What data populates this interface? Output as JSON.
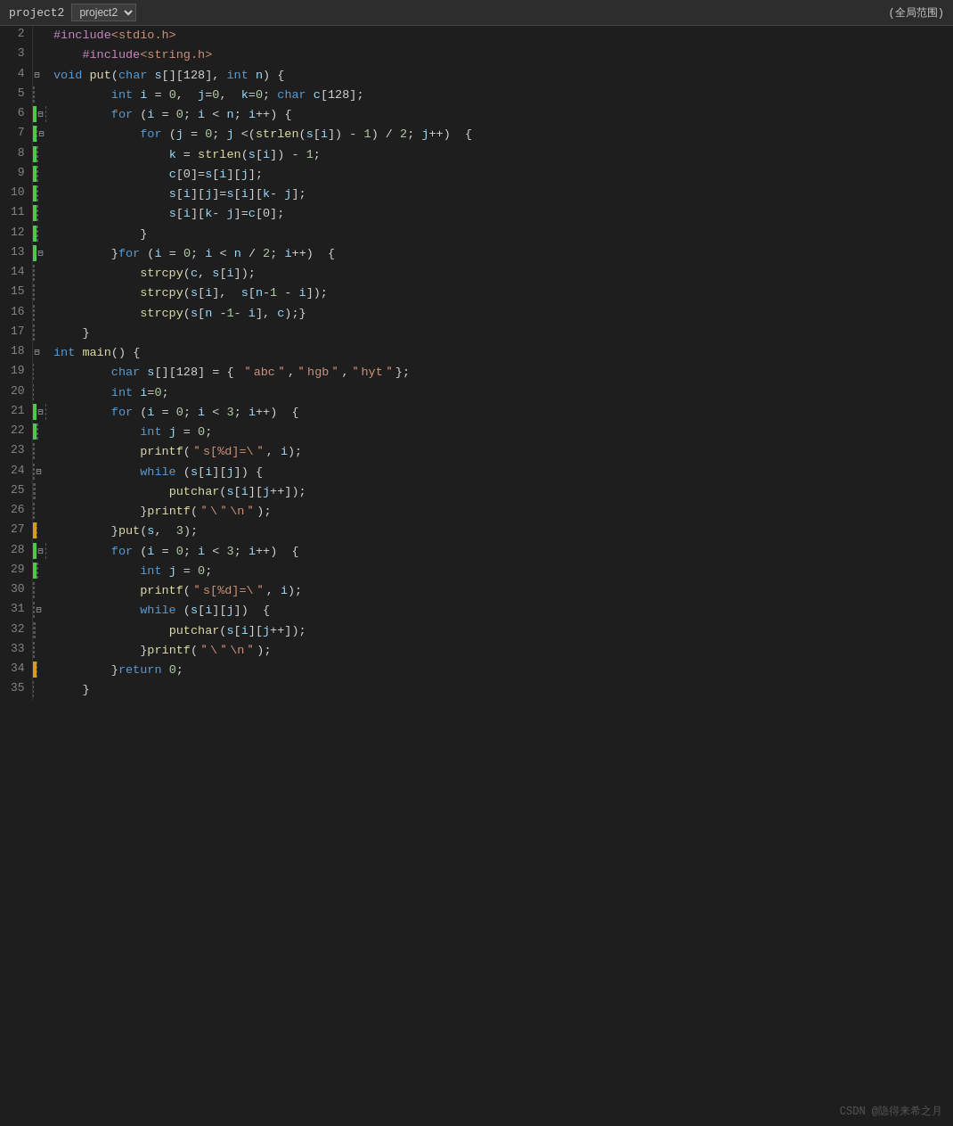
{
  "titlebar": {
    "project": "project2",
    "scope": "(全局范围)"
  },
  "watermark": "CSDN @隐得来希之月",
  "lines": [
    {
      "num": "2",
      "gutter": "none",
      "code": "<inc>#include</inc><hdr>&lt;stdio.h&gt;</hdr>"
    },
    {
      "num": "3",
      "gutter": "none",
      "code": "    <inc>#include</inc><hdr>&lt;string.h&gt;</hdr>"
    },
    {
      "num": "4",
      "gutter": "fold",
      "code": "<kw>void</kw> <fn>put</fn><plain>(</plain><kw>char</kw> <var>s</var><plain>[][128],</plain> <kw>int</kw> <var>n</var><plain>) {</plain>"
    },
    {
      "num": "5",
      "gutter": "dashed",
      "code": "        <kw>int</kw> <var>i</var> <op>=</op> <num>0</num><plain>,</plain>  <var>j</var><op>=</op><num>0</num><plain>,</plain>  <var>k</var><op>=</op><num>0</num><plain>;</plain> <kw>char</kw> <var>c</var><plain>[128];</plain>"
    },
    {
      "num": "6",
      "gutter": "green-fold",
      "code": "        <kw2>for</kw2> <plain>(</plain><var>i</var> <op>=</op> <num>0</num><plain>;</plain> <var>i</var> <op>&lt;</op> <var>n</var><plain>;</plain> <var>i</var><op>++</op><plain>) {</plain>"
    },
    {
      "num": "7",
      "gutter": "green-fold2",
      "code": "            <kw2>for</kw2> <plain>(</plain><var>j</var> <op>=</op> <num>0</num><plain>;</plain> <var>j</var> <op>&lt;(</op><fn>strlen</fn><plain>(</plain><var>s</var><plain>[</plain><var>i</var><plain>])</plain> <op>-</op> <num>1</num><plain>)</plain> <op>/</op> <num>2</num><plain>;</plain> <var>j</var><op>++</op><plain>)  {</plain>"
    },
    {
      "num": "8",
      "gutter": "dashed2",
      "code": "                <var>k</var> <op>=</op> <fn>strlen</fn><plain>(</plain><var>s</var><plain>[</plain><var>i</var><plain>])</plain> <op>-</op> <num>1</num><plain>;</plain>"
    },
    {
      "num": "9",
      "gutter": "dashed2",
      "code": "                <var>c</var><plain>[0]=</plain><var>s</var><plain>[</plain><var>i</var><plain>][</plain><var>j</var><plain>];</plain>"
    },
    {
      "num": "10",
      "gutter": "dashed2",
      "code": "                <var>s</var><plain>[</plain><var>i</var><plain>][</plain><var>j</var><plain>]=</plain><var>s</var><plain>[</plain><var>i</var><plain>][</plain><var>k</var><op>-</op> <var>j</var><plain>];</plain>"
    },
    {
      "num": "11",
      "gutter": "dashed2",
      "code": "                <var>s</var><plain>[</plain><var>i</var><plain>][</plain><var>k</var><op>-</op> <var>j</var><plain>]=</plain><var>c</var><plain>[0];</plain>"
    },
    {
      "num": "12",
      "gutter": "dashed2",
      "code": "            <plain>}</plain>"
    },
    {
      "num": "13",
      "gutter": "green-fold3",
      "code": "        <plain>}</plain><kw2>for</kw2> <plain>(</plain><var>i</var> <op>=</op> <num>0</num><plain>;</plain> <var>i</var> <op>&lt;</op> <var>n</var> <op>/</op> <num>2</num><plain>;</plain> <var>i</var><op>++</op><plain>)  {</plain>"
    },
    {
      "num": "14",
      "gutter": "dashed3",
      "code": "            <fn>strcpy</fn><plain>(</plain><var>c</var><plain>,</plain> <var>s</var><plain>[</plain><var>i</var><plain>]);</plain>"
    },
    {
      "num": "15",
      "gutter": "dashed3",
      "code": "            <fn>strcpy</fn><plain>(</plain><var>s</var><plain>[</plain><var>i</var><plain>],</plain>  <var>s</var><plain>[</plain><var>n</var><op>-</op><num>1</num> <op>-</op> <var>i</var><plain>]);</plain>"
    },
    {
      "num": "16",
      "gutter": "dashed3",
      "code": "            <fn>strcpy</fn><plain>(</plain><var>s</var><plain>[</plain><var>n</var> <op>-</op><num>1</num><op>-</op> <var>i</var><plain>],</plain> <var>c</var><plain>);}</plain>"
    },
    {
      "num": "17",
      "gutter": "dashed",
      "code": "    <plain>}</plain>"
    },
    {
      "num": "18",
      "gutter": "fold2",
      "code": "<kw>int</kw> <fn>main</fn><plain>() {</plain>"
    },
    {
      "num": "19",
      "gutter": "dashed4",
      "code": "        <kw>char</kw> <var>s</var><plain>[][128] = { </plain><str>&#xFF02;abc&#xFF02;</str><plain>,</plain><str>&#xFF02;hgb&#xFF02;</str><plain>,</plain><str>&#xFF02;hyt&#xFF02;</str><plain>};</plain>"
    },
    {
      "num": "20",
      "gutter": "dashed4",
      "code": "        <kw>int</kw> <var>i</var><op>=</op><num>0</num><plain>;</plain>"
    },
    {
      "num": "21",
      "gutter": "green-fold4",
      "code": "        <kw2>for</kw2> <plain>(</plain><var>i</var> <op>=</op> <num>0</num><plain>;</plain> <var>i</var> <op>&lt;</op> <num>3</num><plain>;</plain> <var>i</var><op>++</op><plain>)  {</plain>"
    },
    {
      "num": "22",
      "gutter": "green-dashed",
      "code": "            <kw>int</kw> <var>j</var> <op>=</op> <num>0</num><plain>;</plain>"
    },
    {
      "num": "23",
      "gutter": "dashed5",
      "code": "            <fn>printf</fn><plain>(</plain><str>&#xFF02;s[%d]=\\&#xFF02;</str><plain>,</plain> <var>i</var><plain>);</plain>"
    },
    {
      "num": "24",
      "gutter": "fold5",
      "code": "            <kw2>while</kw2> <plain>(</plain><var>s</var><plain>[</plain><var>i</var><plain>][</plain><var>j</var><plain>]) {</plain>"
    },
    {
      "num": "25",
      "gutter": "dashed6",
      "code": "                <fn>putchar</fn><plain>(</plain><var>s</var><plain>[</plain><var>i</var><plain>][</plain><var>j</var><op>++</op><plain>]);</plain>"
    },
    {
      "num": "26",
      "gutter": "dashed5",
      "code": "            <plain>}</plain><fn>printf</fn><plain>(</plain><str>&#xFF02;\\&#xFF02;\\n&#xFF02;</str><plain>);</plain>"
    },
    {
      "num": "27",
      "gutter": "yellow-dashed",
      "code": "        <plain>}</plain><fn>put</fn><plain>(</plain><var>s</var><plain>,</plain>  <num>3</num><plain>);</plain>"
    },
    {
      "num": "28",
      "gutter": "green-fold6",
      "code": "        <kw2>for</kw2> <plain>(</plain><var>i</var> <op>=</op> <num>0</num><plain>;</plain> <var>i</var> <op>&lt;</op> <num>3</num><plain>;</plain> <var>i</var><op>++</op><plain>)  {</plain>"
    },
    {
      "num": "29",
      "gutter": "green-dashed2",
      "code": "            <kw>int</kw> <var>j</var> <op>=</op> <num>0</num><plain>;</plain>"
    },
    {
      "num": "30",
      "gutter": "dashed7",
      "code": "            <fn>printf</fn><plain>(</plain><str>&#xFF02;s[%d]=\\&#xFF02;</str><plain>,</plain> <var>i</var><plain>);</plain>"
    },
    {
      "num": "31",
      "gutter": "fold6",
      "code": "            <kw2>while</kw2> <plain>(</plain><var>s</var><plain>[</plain><var>i</var><plain>][</plain><var>j</var><plain>])  {</plain>"
    },
    {
      "num": "32",
      "gutter": "dashed8",
      "code": "                <fn>putchar</fn><plain>(</plain><var>s</var><plain>[</plain><var>i</var><plain>][</plain><var>j</var><op>++</op><plain>]);</plain>"
    },
    {
      "num": "33",
      "gutter": "dashed7",
      "code": "            <plain>}</plain><fn>printf</fn><plain>(</plain><str>&#xFF02;\\&#xFF02;\\n&#xFF02;</str><plain>);</plain>"
    },
    {
      "num": "34",
      "gutter": "yellow-dashed2",
      "code": "        <plain>}</plain><kw2>return</kw2> <num>0</num><plain>;</plain>"
    },
    {
      "num": "35",
      "gutter": "dashed4",
      "code": "    <plain>}</plain>"
    }
  ]
}
